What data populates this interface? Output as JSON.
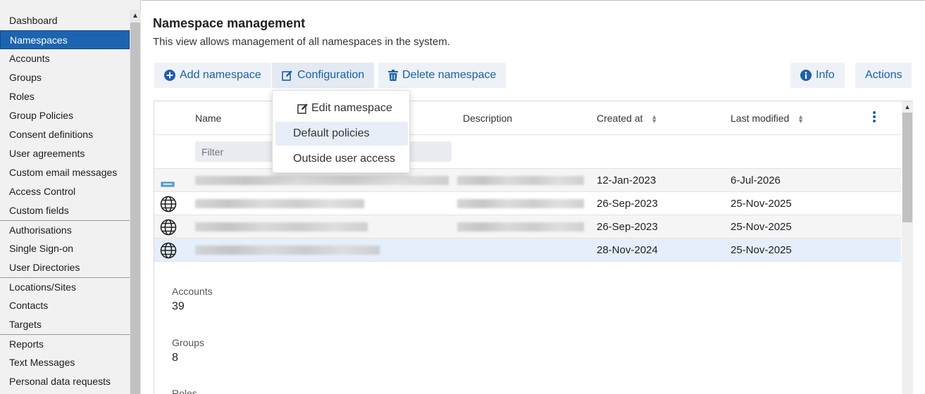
{
  "sidebar": {
    "items": [
      {
        "label": "Dashboard"
      },
      {
        "label": "Namespaces"
      },
      {
        "label": "Accounts"
      },
      {
        "label": "Groups"
      },
      {
        "label": "Roles"
      },
      {
        "label": "Group Policies"
      },
      {
        "label": "Consent definitions"
      },
      {
        "label": "User agreements"
      },
      {
        "label": "Custom email messages"
      },
      {
        "label": "Access Control"
      },
      {
        "label": "Custom fields"
      },
      {
        "label": "Authorisations"
      },
      {
        "label": "Single Sign-on"
      },
      {
        "label": "User Directories"
      },
      {
        "label": "Locations/Sites"
      },
      {
        "label": "Contacts"
      },
      {
        "label": "Targets"
      },
      {
        "label": "Reports"
      },
      {
        "label": "Text Messages"
      },
      {
        "label": "Personal data requests"
      }
    ],
    "active": "Namespaces"
  },
  "page": {
    "title": "Namespace management",
    "description": "This view allows management of all namespaces in the system."
  },
  "toolbar": {
    "add_label": "Add namespace",
    "config_label": "Configuration",
    "delete_label": "Delete namespace",
    "info_label": "Info",
    "actions_label": "Actions",
    "icons": {
      "add": "plus-circle-icon",
      "config": "edit-icon",
      "delete": "trash-icon",
      "info": "info-circle-icon"
    }
  },
  "dropdown": {
    "items": [
      {
        "label": "Edit namespace",
        "icon": "edit-icon"
      },
      {
        "label": "Default policies"
      },
      {
        "label": "Outside user access"
      }
    ],
    "highlighted": "Default policies"
  },
  "table": {
    "columns": {
      "name": "Name",
      "description": "Description",
      "created": "Created at",
      "modified": "Last modified"
    },
    "filter_placeholder": "Filter",
    "rows": [
      {
        "icon": "flag-icon",
        "created": "12-Jan-2023",
        "modified": "6-Jul-2026"
      },
      {
        "icon": "globe-icon",
        "created": "26-Sep-2023",
        "modified": "25-Nov-2025"
      },
      {
        "icon": "globe-icon",
        "created": "26-Sep-2023",
        "modified": "25-Nov-2025"
      },
      {
        "icon": "globe-icon",
        "created": "28-Nov-2024",
        "modified": "25-Nov-2025",
        "selected": true
      }
    ]
  },
  "details": {
    "accounts_label": "Accounts",
    "accounts_value": "39",
    "groups_label": "Groups",
    "groups_value": "8",
    "roles_label": "Roles"
  },
  "colors": {
    "accent": "#1a5fb0",
    "active_nav": "#1d64b0",
    "selected_row": "#e4effb"
  }
}
